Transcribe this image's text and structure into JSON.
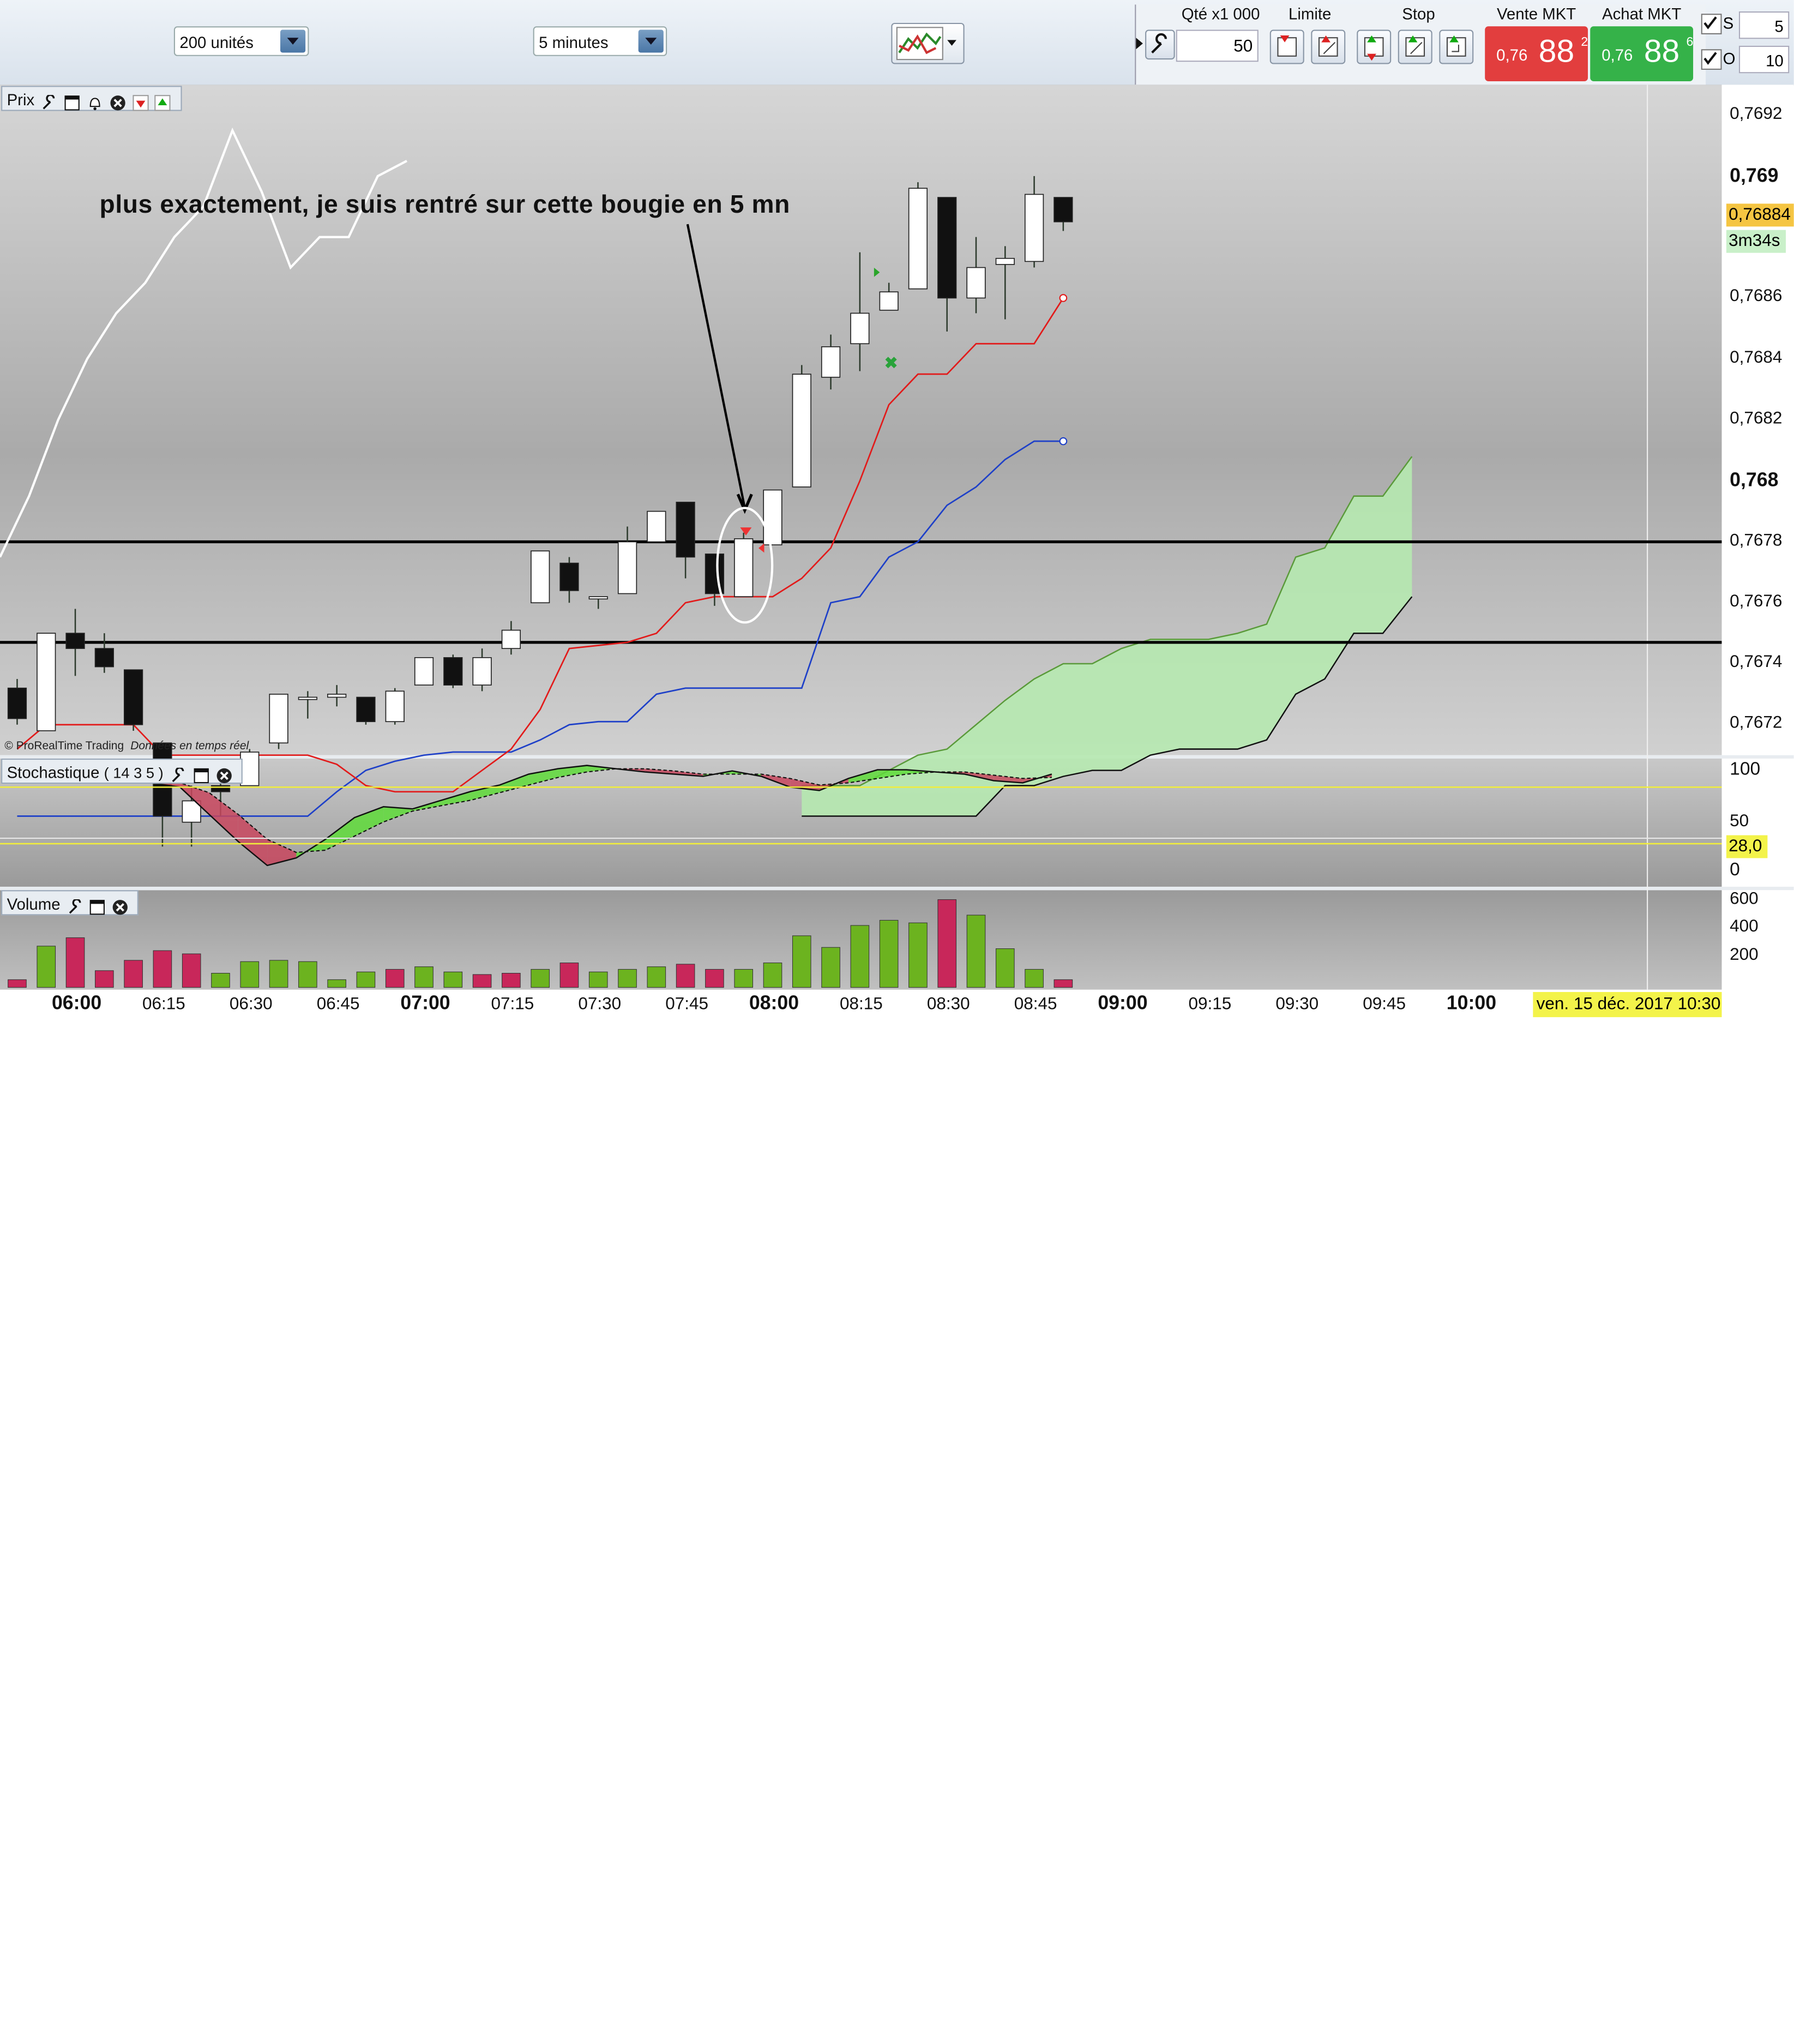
{
  "toolbar": {
    "units_select": "200 unités",
    "timeframe_select": "5 minutes",
    "qty_header": "Qté x1 000",
    "qty_value": "50",
    "limit_header": "Limite",
    "stop_header": "Stop",
    "sell_header": "Vente MKT",
    "buy_header": "Achat MKT",
    "sell_price_prefix": "0,76",
    "sell_price_big": "88",
    "sell_price_sup": "2",
    "buy_price_prefix": "0,76",
    "buy_price_big": "88",
    "buy_price_sup": "6",
    "s_label": "S",
    "s_value": "5",
    "o_label": "O",
    "o_value": "10",
    "sell_color": "#e53b3b",
    "buy_color": "#36b24a"
  },
  "price_panel": {
    "label": "Prix",
    "annotation": "plus exactement, je suis rentré sur cette bougie en 5 mn",
    "copyright": "© ProRealTime Trading",
    "data_note": "Données en temps réel",
    "current_price_label": "0,76884",
    "countdown_label": "3m34s",
    "y_labels": [
      {
        "text": "0,7692",
        "value": 0.7692,
        "bold": false
      },
      {
        "text": "0,769",
        "value": 0.769,
        "bold": true
      },
      {
        "text": "0,7686",
        "value": 0.7686,
        "bold": false
      },
      {
        "text": "0,7684",
        "value": 0.7684,
        "bold": false
      },
      {
        "text": "0,7682",
        "value": 0.7682,
        "bold": false
      },
      {
        "text": "0,768",
        "value": 0.768,
        "bold": true
      },
      {
        "text": "0,7678",
        "value": 0.7678,
        "bold": false
      },
      {
        "text": "0,7676",
        "value": 0.7676,
        "bold": false
      },
      {
        "text": "0,7674",
        "value": 0.7674,
        "bold": false
      },
      {
        "text": "0,7672",
        "value": 0.7672,
        "bold": false
      }
    ]
  },
  "stoch_panel": {
    "label": "Stochastique",
    "params": "( 14 3 5 )",
    "y_labels": [
      "100",
      "50",
      "0"
    ],
    "level_label": "28,0"
  },
  "volume_panel": {
    "label": "Volume",
    "y_labels": [
      "600",
      "400",
      "200"
    ]
  },
  "x_axis": {
    "labels": [
      {
        "text": "06:00",
        "bold": true
      },
      {
        "text": "06:15",
        "bold": false
      },
      {
        "text": "06:30",
        "bold": false
      },
      {
        "text": "06:45",
        "bold": false
      },
      {
        "text": "07:00",
        "bold": true
      },
      {
        "text": "07:15",
        "bold": false
      },
      {
        "text": "07:30",
        "bold": false
      },
      {
        "text": "07:45",
        "bold": false
      },
      {
        "text": "08:00",
        "bold": true
      },
      {
        "text": "08:15",
        "bold": false
      },
      {
        "text": "08:30",
        "bold": false
      },
      {
        "text": "08:45",
        "bold": false
      },
      {
        "text": "09:00",
        "bold": true
      },
      {
        "text": "09:15",
        "bold": false
      },
      {
        "text": "09:30",
        "bold": false
      },
      {
        "text": "09:45",
        "bold": false
      },
      {
        "text": "10:00",
        "bold": true
      }
    ],
    "date_label": "ven. 15 déc. 2017 10:30"
  },
  "chart_data": {
    "type": "candlestick",
    "interval": "5 minutes",
    "ylim": [
      0.7671,
      0.7693
    ],
    "horizontal_lines": [
      0.7678,
      0.76747
    ],
    "candles": [
      {
        "o": 0.76732,
        "h": 0.76735,
        "l": 0.7672,
        "c": 0.76722
      },
      {
        "o": 0.76718,
        "h": 0.7675,
        "l": 0.76718,
        "c": 0.7675
      },
      {
        "o": 0.7675,
        "h": 0.76758,
        "l": 0.76736,
        "c": 0.76745
      },
      {
        "o": 0.76745,
        "h": 0.7675,
        "l": 0.76737,
        "c": 0.76739
      },
      {
        "o": 0.76738,
        "h": 0.76738,
        "l": 0.76718,
        "c": 0.7672
      },
      {
        "o": 0.76714,
        "h": 0.76714,
        "l": 0.7668,
        "c": 0.7669
      },
      {
        "o": 0.76688,
        "h": 0.767,
        "l": 0.7668,
        "c": 0.76695
      },
      {
        "o": 0.767,
        "h": 0.76706,
        "l": 0.7669,
        "c": 0.76698
      },
      {
        "o": 0.767,
        "h": 0.76712,
        "l": 0.767,
        "c": 0.76711
      },
      {
        "o": 0.76714,
        "h": 0.7673,
        "l": 0.76712,
        "c": 0.7673
      },
      {
        "o": 0.76729,
        "h": 0.76731,
        "l": 0.76722,
        "c": 0.76729
      },
      {
        "o": 0.76729,
        "h": 0.76733,
        "l": 0.76726,
        "c": 0.7673
      },
      {
        "o": 0.76729,
        "h": 0.76729,
        "l": 0.7672,
        "c": 0.76721
      },
      {
        "o": 0.76721,
        "h": 0.76732,
        "l": 0.7672,
        "c": 0.76731
      },
      {
        "o": 0.76733,
        "h": 0.76742,
        "l": 0.76733,
        "c": 0.76742
      },
      {
        "o": 0.76742,
        "h": 0.76743,
        "l": 0.76732,
        "c": 0.76733
      },
      {
        "o": 0.76733,
        "h": 0.76745,
        "l": 0.76731,
        "c": 0.76742
      },
      {
        "o": 0.76745,
        "h": 0.76754,
        "l": 0.76743,
        "c": 0.76751
      },
      {
        "o": 0.7676,
        "h": 0.7676,
        "l": 0.7676,
        "c": 0.76777
      },
      {
        "o": 0.76773,
        "h": 0.76775,
        "l": 0.7676,
        "c": 0.76764
      },
      {
        "o": 0.76762,
        "h": 0.76762,
        "l": 0.76758,
        "c": 0.76762
      },
      {
        "o": 0.76763,
        "h": 0.76785,
        "l": 0.76763,
        "c": 0.7678
      },
      {
        "o": 0.7678,
        "h": 0.76786,
        "l": 0.7678,
        "c": 0.7679
      },
      {
        "o": 0.76793,
        "h": 0.76793,
        "l": 0.76768,
        "c": 0.76775
      },
      {
        "o": 0.76776,
        "h": 0.76776,
        "l": 0.76759,
        "c": 0.76763
      },
      {
        "o": 0.76762,
        "h": 0.76783,
        "l": 0.76762,
        "c": 0.76781
      },
      {
        "o": 0.76779,
        "h": 0.76797,
        "l": 0.76779,
        "c": 0.76797
      },
      {
        "o": 0.76798,
        "h": 0.76838,
        "l": 0.76798,
        "c": 0.76835
      },
      {
        "o": 0.76834,
        "h": 0.76848,
        "l": 0.7683,
        "c": 0.76844
      },
      {
        "o": 0.76845,
        "h": 0.76875,
        "l": 0.76836,
        "c": 0.76855
      },
      {
        "o": 0.76856,
        "h": 0.76865,
        "l": 0.76856,
        "c": 0.76862
      },
      {
        "o": 0.76863,
        "h": 0.76898,
        "l": 0.76863,
        "c": 0.76896
      },
      {
        "o": 0.76893,
        "h": 0.76893,
        "l": 0.76849,
        "c": 0.7686
      },
      {
        "o": 0.7686,
        "h": 0.7688,
        "l": 0.76855,
        "c": 0.7687
      },
      {
        "o": 0.76871,
        "h": 0.76877,
        "l": 0.76853,
        "c": 0.76873
      },
      {
        "o": 0.76872,
        "h": 0.769,
        "l": 0.7687,
        "c": 0.76894
      },
      {
        "o": 0.76893,
        "h": 0.76893,
        "l": 0.76882,
        "c": 0.76885
      }
    ],
    "volume": [
      60,
      320,
      385,
      130,
      210,
      285,
      260,
      110,
      200,
      210,
      200,
      60,
      120,
      140,
      160,
      120,
      100,
      110,
      140,
      190,
      120,
      140,
      160,
      180,
      140,
      140,
      190,
      400,
      310,
      480,
      520,
      500,
      680,
      560,
      300,
      140,
      60
    ],
    "volume_up": [
      false,
      true,
      false,
      false,
      false,
      false,
      false,
      true,
      true,
      true,
      true,
      true,
      true,
      false,
      true,
      true,
      false,
      false,
      true,
      false,
      true,
      true,
      true,
      false,
      false,
      true,
      true,
      true,
      true,
      true,
      true,
      true,
      false,
      true,
      true,
      true,
      false
    ],
    "volume_ylim": [
      0,
      700
    ],
    "stochastic": {
      "k": [
        95,
        93,
        90,
        88,
        85,
        84,
        80,
        55,
        30,
        8,
        15,
        32,
        52,
        62,
        60,
        68,
        76,
        82,
        92,
        97,
        100,
        97,
        94,
        92,
        90,
        95,
        90,
        80,
        77,
        88,
        96,
        96,
        94,
        92,
        86,
        84,
        92
      ],
      "d": [
        94,
        92,
        90,
        89,
        87,
        86,
        84,
        75,
        55,
        32,
        20,
        22,
        35,
        48,
        58,
        63,
        68,
        75,
        82,
        89,
        94,
        97,
        97,
        95,
        92,
        92,
        92,
        88,
        82,
        84,
        88,
        92,
        94,
        94,
        91,
        88,
        89
      ],
      "levels": [
        80,
        28
      ]
    },
    "ichimoku": {
      "tenkan_red": [
        0.76712,
        0.7672,
        0.7672,
        0.7672,
        0.7672,
        0.7671,
        0.7671,
        0.7671,
        0.7671,
        0.7671,
        0.7671,
        0.76707,
        0.767,
        0.76698,
        0.76698,
        0.76698,
        0.76705,
        0.76712,
        0.76725,
        0.76745,
        0.76746,
        0.76747,
        0.7675,
        0.7676,
        0.76762,
        0.76762,
        0.76762,
        0.76768,
        0.76778,
        0.768,
        0.76825,
        0.76835,
        0.76835,
        0.76845,
        0.76845,
        0.76845,
        0.7686
      ],
      "kijun_blue": [
        0.7669,
        0.7669,
        0.7669,
        0.7669,
        0.7669,
        0.7669,
        0.7669,
        0.7669,
        0.7669,
        0.7669,
        0.7669,
        0.76698,
        0.76705,
        0.76708,
        0.7671,
        0.76711,
        0.76711,
        0.76711,
        0.76715,
        0.7672,
        0.76721,
        0.76721,
        0.7673,
        0.76732,
        0.76732,
        0.76732,
        0.76732,
        0.76732,
        0.7676,
        0.76762,
        0.76775,
        0.7678,
        0.76792,
        0.76798,
        0.76807,
        0.76813,
        0.76813
      ],
      "chikou_white": [
        0.76775,
        0.76795,
        0.7682,
        0.7684,
        0.76855,
        0.76865,
        0.7688,
        0.7689,
        0.76915,
        0.76895,
        0.7687,
        0.7688,
        0.7688,
        0.769,
        0.76905
      ]
    }
  }
}
